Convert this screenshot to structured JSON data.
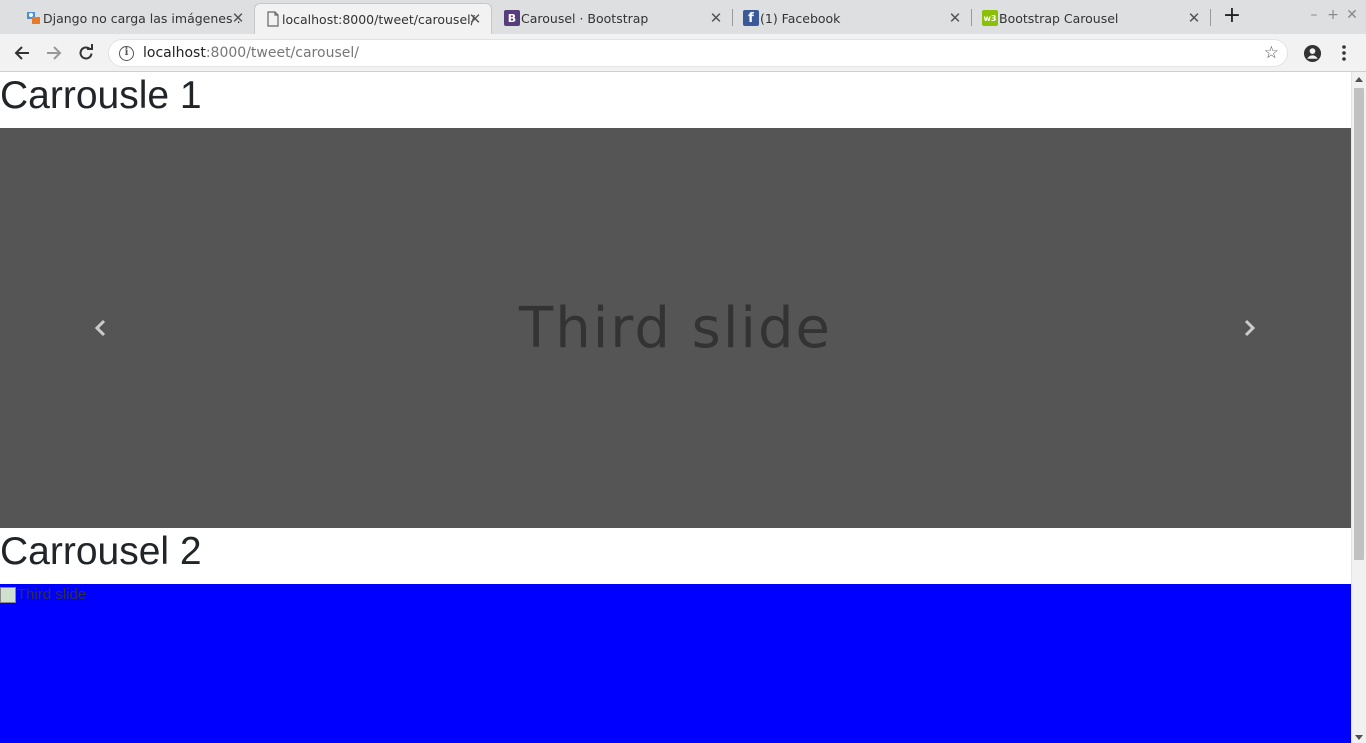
{
  "tabs": [
    {
      "title": "Django no carga las imágenes :",
      "favicon": "stackoverflow-icon",
      "active": false
    },
    {
      "title": "localhost:8000/tweet/carousel/",
      "favicon": "page-icon",
      "active": true
    },
    {
      "title": "Carousel · Bootstrap",
      "favicon": "bootstrap-icon",
      "favicon_letter": "B",
      "active": false
    },
    {
      "title": "(1) Facebook",
      "favicon": "facebook-icon",
      "favicon_letter": "f",
      "active": false
    },
    {
      "title": "Bootstrap Carousel",
      "favicon": "w3schools-icon",
      "favicon_letter": "w3",
      "active": false
    }
  ],
  "tab_close_glyph": "✕",
  "new_tab_glyph": "+",
  "window_controls": {
    "minimize": "–",
    "maximize": "+",
    "close": "✕"
  },
  "address": {
    "host": "localhost",
    "path": ":8000/tweet/carousel/"
  },
  "page": {
    "heading1": "Carrousle 1",
    "carousel1_slide_text": "Third slide",
    "heading2": "Carrousel 2",
    "carousel2_broken_alt": "Third slide"
  },
  "colors": {
    "carousel1_bg": "#555555",
    "carousel2_bg": "#0000ff",
    "chrome_tabstrip": "#dedfe1",
    "chrome_toolbar": "#f2f2f2"
  }
}
